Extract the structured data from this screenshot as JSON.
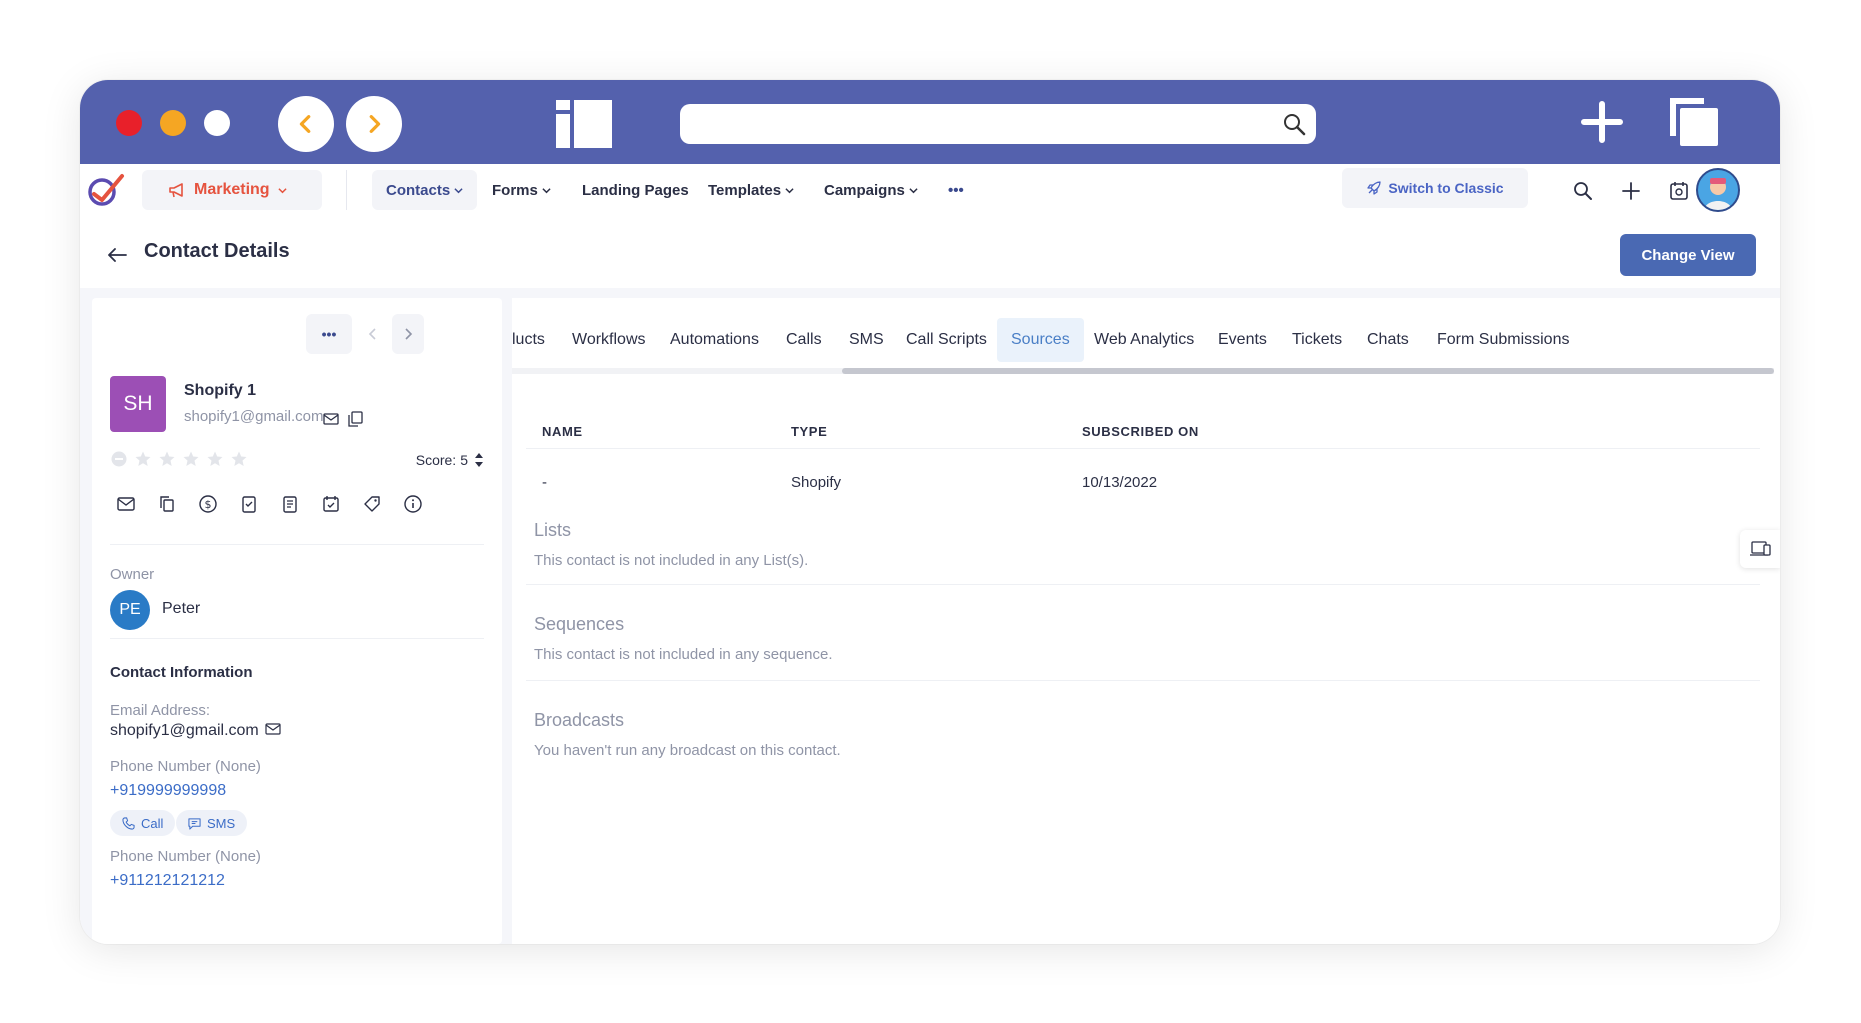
{
  "browser": {
    "traffic_lights": [
      "#e8202a",
      "#f5a623",
      "#ffffff"
    ],
    "chrome_color": "#5461ad",
    "url": ""
  },
  "nav": {
    "module": "Marketing",
    "items": [
      "Contacts",
      "Forms",
      "Landing Pages",
      "Templates",
      "Campaigns"
    ],
    "more": "•••",
    "switch_classic": "Switch to Classic"
  },
  "header": {
    "title": "Contact Details",
    "change_view": "Change View"
  },
  "contact": {
    "initials": "SH",
    "name": "Shopify 1",
    "email": "shopify1@gmail.com",
    "more": "•••",
    "score_label": "Score:",
    "score": "5",
    "rating": 0,
    "owner_label": "Owner",
    "owner_initials": "PE",
    "owner_name": "Peter",
    "info_title": "Contact Information",
    "email_label": "Email Address:",
    "email_value": "shopify1@gmail.com",
    "phone1_label": "Phone Number (None)",
    "phone1_value": "+919999999998",
    "call_label": "Call",
    "sms_label": "SMS",
    "phone2_label": "Phone Number (None)",
    "phone2_value": "+911212121212"
  },
  "tabs": [
    "lucts",
    "Workflows",
    "Automations",
    "Calls",
    "SMS",
    "Call Scripts",
    "Sources",
    "Web Analytics",
    "Events",
    "Tickets",
    "Chats",
    "Form Submissions"
  ],
  "active_tab": "Sources",
  "sources_table": {
    "columns": [
      "NAME",
      "TYPE",
      "SUBSCRIBED ON"
    ],
    "rows": [
      [
        "-",
        "Shopify",
        "10/13/2022"
      ]
    ]
  },
  "sections": {
    "lists_title": "Lists",
    "lists_text": "This contact is not included in any List(s).",
    "sequences_title": "Sequences",
    "sequences_text": "This contact is not included in any sequence.",
    "broadcasts_title": "Broadcasts",
    "broadcasts_text": "You haven't run any broadcast on this contact."
  }
}
